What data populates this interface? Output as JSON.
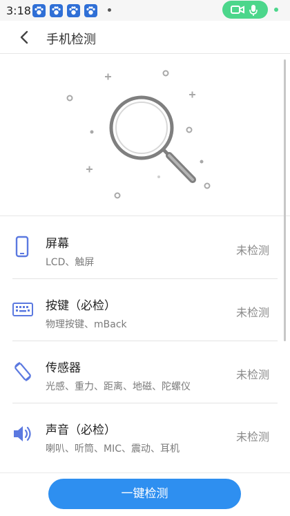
{
  "status_bar": {
    "time": "3:18",
    "notification_icons": [
      "paw-icon",
      "paw-icon",
      "paw-icon",
      "paw-icon",
      "paw-icon"
    ],
    "call_icons": [
      "video-camera-icon",
      "microphone-icon"
    ],
    "accent": "#4cd68b"
  },
  "header": {
    "title": "手机检测",
    "back_icon": "chevron-left-icon"
  },
  "items": [
    {
      "icon": "phone-icon",
      "name": "屏幕",
      "detail": "LCD、触屏",
      "status": "未检测"
    },
    {
      "icon": "keyboard-icon",
      "name": "按键（必检）",
      "detail": "物理按键、mBack",
      "status": "未检测"
    },
    {
      "icon": "rotate-icon",
      "name": "传感器",
      "detail": "光感、重力、距离、地磁、陀螺仪",
      "status": "未检测"
    },
    {
      "icon": "speaker-icon",
      "name": "声音（必检）",
      "detail": "喇叭、听筒、MIC、震动、耳机",
      "status": "未检测"
    }
  ],
  "action": {
    "label": "一键检测",
    "color": "#2e8ff0"
  },
  "colors": {
    "icon_blue": "#5b79e0"
  }
}
